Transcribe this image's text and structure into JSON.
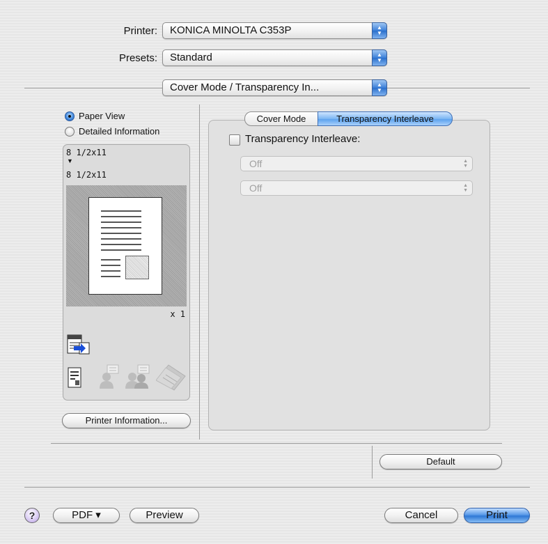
{
  "printer": {
    "label": "Printer:",
    "value": "KONICA MINOLTA C353P"
  },
  "presets": {
    "label": "Presets:",
    "value": "Standard"
  },
  "pane": {
    "value": "Cover Mode / Transparency In..."
  },
  "view_options": [
    {
      "label": "Paper View",
      "selected": true
    },
    {
      "label": "Detailed Information",
      "selected": false
    }
  ],
  "paper": {
    "source": "8 1/2x11",
    "arrow": "▼",
    "output": "8 1/2x11",
    "copies": "x 1"
  },
  "printer_info_button": "Printer Information...",
  "tabs": [
    {
      "label": "Cover Mode",
      "selected": false
    },
    {
      "label": "Transparency Interleave",
      "selected": true
    }
  ],
  "transparency": {
    "checkbox_label": "Transparency Interleave:",
    "checked": false,
    "select1": "Off",
    "select2": "Off"
  },
  "default_button": "Default",
  "footer": {
    "help": "?",
    "pdf": "PDF ▾",
    "preview": "Preview",
    "cancel": "Cancel",
    "print": "Print"
  },
  "colors": {
    "accent": "#3b7fd8",
    "panel": "#e1e1e1"
  }
}
